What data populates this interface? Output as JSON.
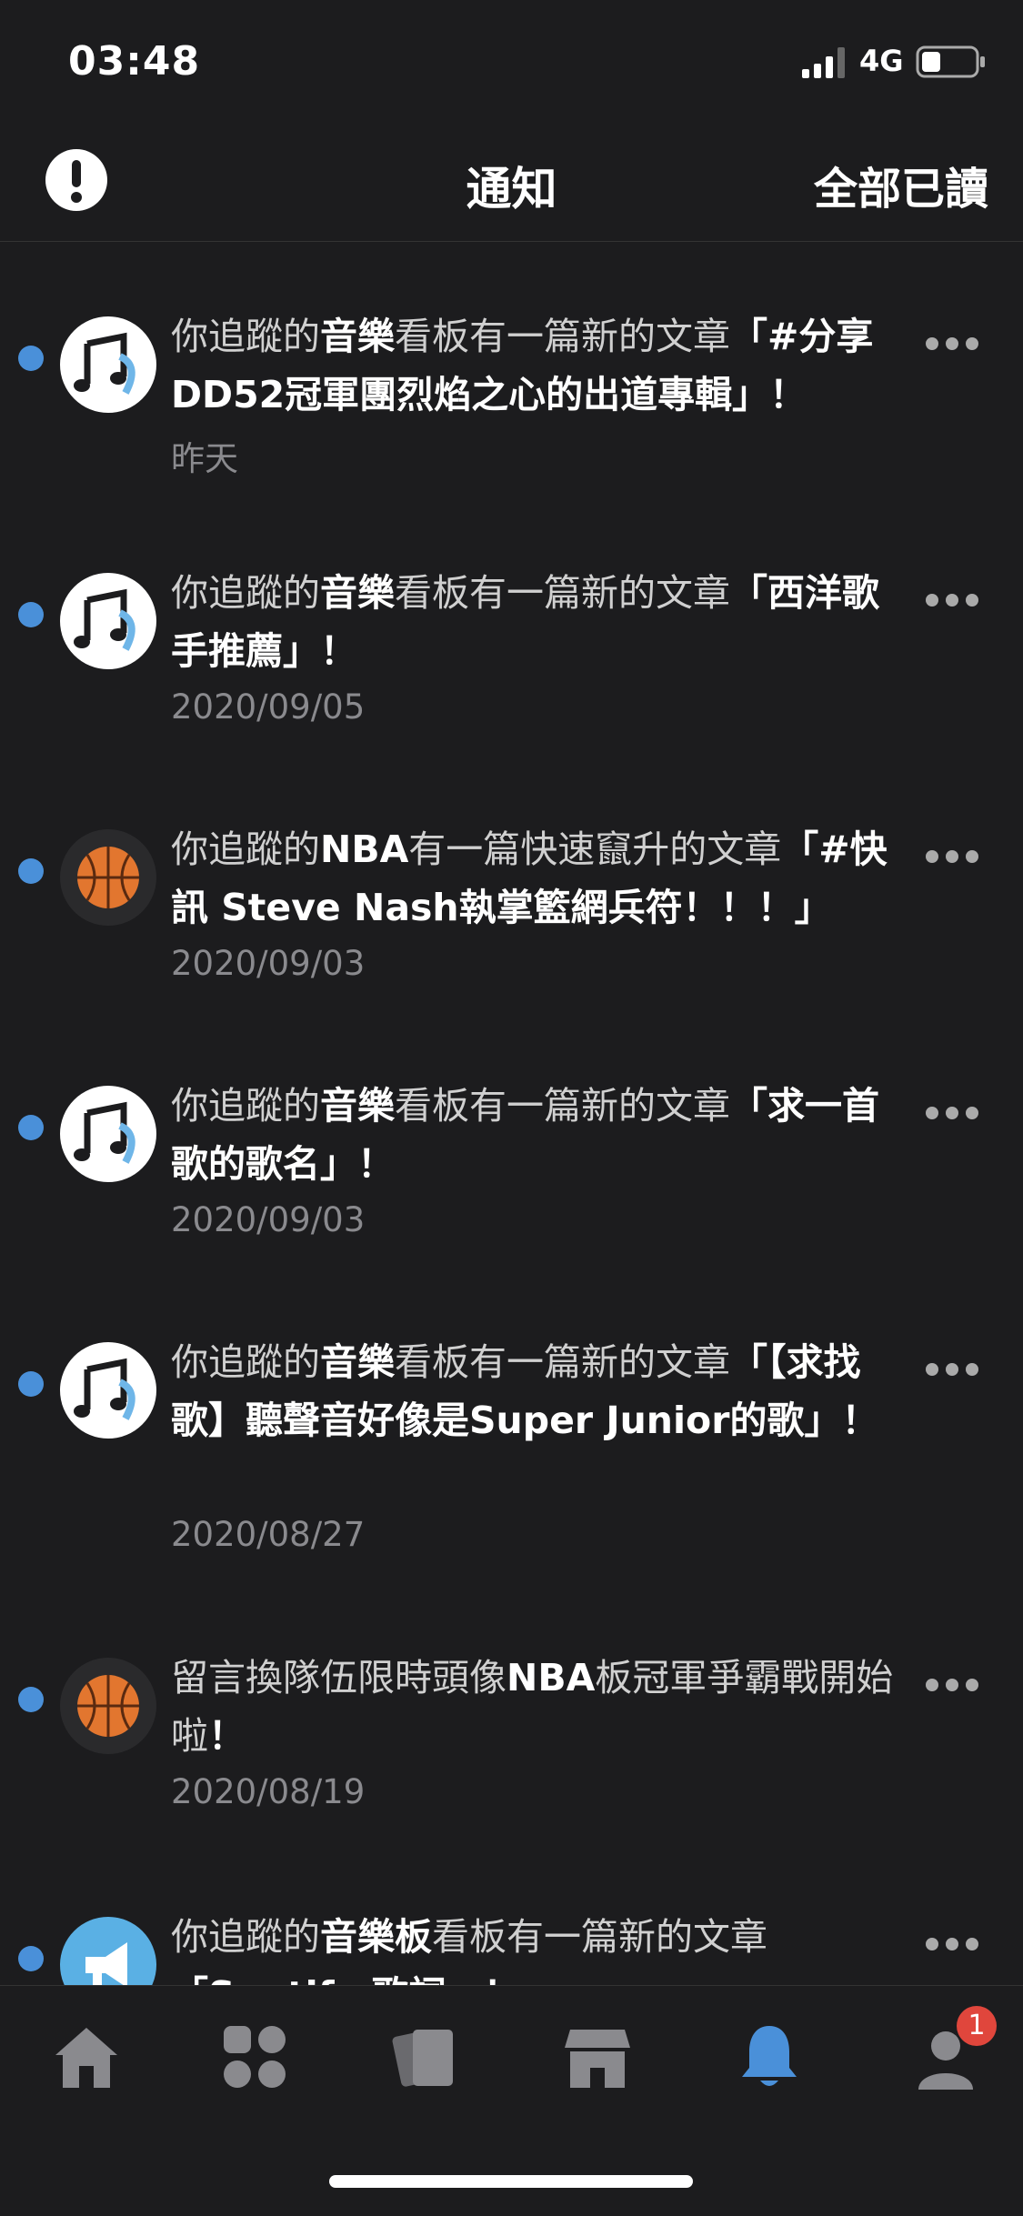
{
  "status": {
    "time": "03:48",
    "network": "4G"
  },
  "header": {
    "title": "通知",
    "mark_all_read": "全部已讀"
  },
  "notifications": [
    {
      "prefix": "你追蹤的",
      "board": "音樂",
      "mid": "看板有一篇新的文章",
      "quote": "「#分享 DD52冠軍團烈焰之心的出道專輯」",
      "end": "！",
      "date": "昨天",
      "avatar": "music-icon"
    },
    {
      "prefix": "你追蹤的",
      "board": "音樂",
      "mid": "看板有一篇新的文章",
      "quote": "「西洋歌手推薦」",
      "end": "！",
      "date": "2020/09/05",
      "avatar": "music-icon"
    },
    {
      "prefix": "你追蹤的",
      "board": "NBA",
      "mid": "有一篇快速竄升的文章",
      "quote": "「#快訊 Steve Nash執掌籃網兵符！！！」",
      "end": "",
      "date": "2020/09/03",
      "avatar": "basketball-icon"
    },
    {
      "prefix": "你追蹤的",
      "board": "音樂",
      "mid": "看板有一篇新的文章",
      "quote": "「求一首歌的歌名」",
      "end": "！",
      "date": "2020/09/03",
      "avatar": "music-icon"
    },
    {
      "prefix": "你追蹤的",
      "board": "音樂",
      "mid": "看板有一篇新的文章",
      "quote": "「【求找歌】聽聲音好像是Super Junior的歌」",
      "end": "！",
      "date": "2020/08/27",
      "avatar": "music-icon"
    },
    {
      "prefix": "留言換隊伍限時頭像",
      "board": "NBA",
      "mid": "板冠軍爭霸戰開始啦",
      "quote": "",
      "end": "！",
      "date": "2020/08/19",
      "avatar": "basketball-icon"
    },
    {
      "prefix": "你追蹤的",
      "board": "音樂板",
      "mid": "看板有一篇新的文章",
      "quote": "「Spotify 歌詞」",
      "end": "！",
      "date": "",
      "avatar": "megaphone-icon"
    }
  ],
  "tabs": [
    {
      "icon": "home-icon"
    },
    {
      "icon": "boards-icon"
    },
    {
      "icon": "cards-icon"
    },
    {
      "icon": "shop-icon"
    },
    {
      "icon": "bell-icon"
    },
    {
      "icon": "profile-icon",
      "badge": "1"
    }
  ],
  "colors": {
    "accent": "#4a90d9",
    "badge": "#e0463c",
    "background": "#1c1c1e"
  }
}
